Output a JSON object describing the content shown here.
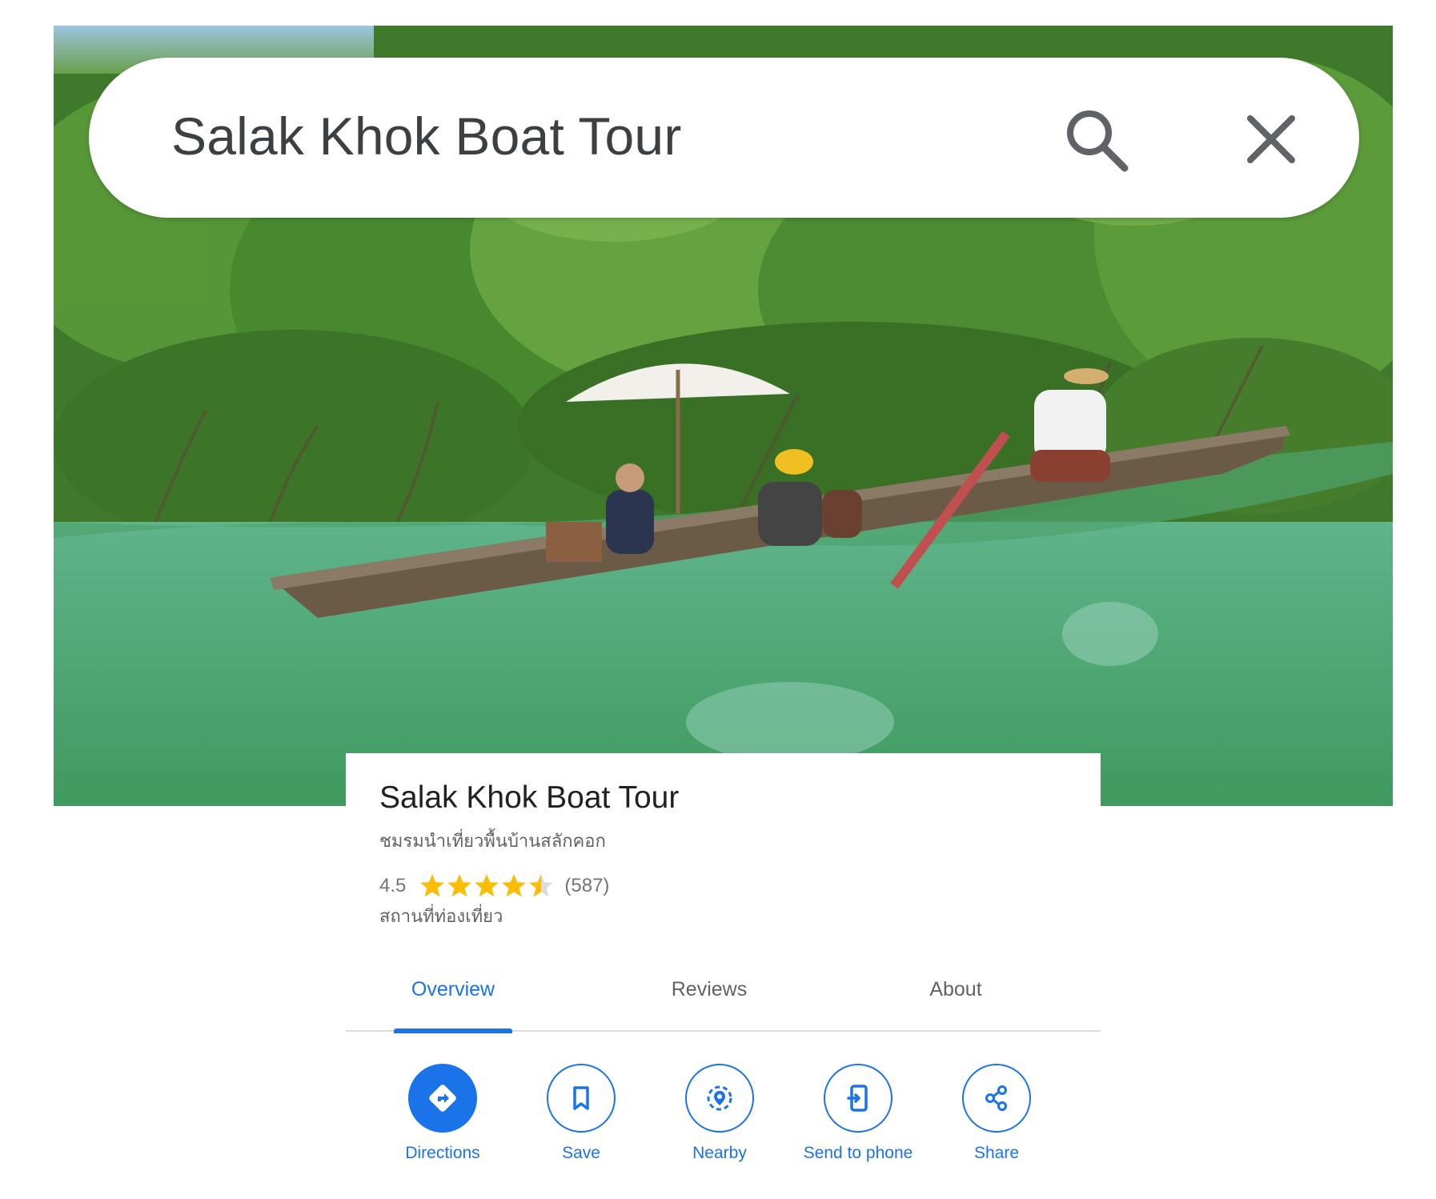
{
  "search": {
    "query": "Salak Khok Boat Tour"
  },
  "place": {
    "title": "Salak Khok Boat Tour",
    "subtitle": "ชมรมนำเที่ยวพื้นบ้านสลักคอก",
    "rating": "4.5",
    "rating_value": 4.5,
    "review_count": "(587)",
    "category": "สถานที่ท่องเที่ยว"
  },
  "tabs": [
    {
      "label": "Overview",
      "active": true
    },
    {
      "label": "Reviews",
      "active": false
    },
    {
      "label": "About",
      "active": false
    }
  ],
  "actions": [
    {
      "label": "Directions",
      "icon": "directions-icon"
    },
    {
      "label": "Save",
      "icon": "bookmark-icon"
    },
    {
      "label": "Nearby",
      "icon": "nearby-icon"
    },
    {
      "label": "Send to phone",
      "icon": "send-to-phone-icon"
    },
    {
      "label": "Share",
      "icon": "share-icon"
    }
  ],
  "colors": {
    "accent": "#1a73e8",
    "star": "#fbbc04",
    "star_empty": "#dadce0"
  }
}
